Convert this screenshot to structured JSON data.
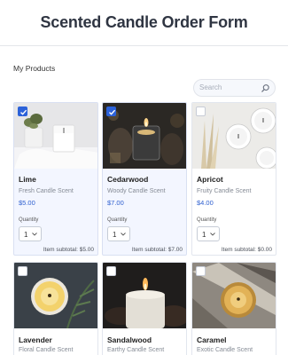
{
  "header": {
    "title": "Scented Candle Order Form"
  },
  "section": {
    "label": "My Products"
  },
  "search": {
    "placeholder": "Search"
  },
  "colors": {
    "accent": "#2c62d9",
    "price": "#2e5fcf",
    "selected_bg": "#f3f6ff"
  },
  "products": [
    {
      "name": "Lime",
      "scent": "Fresh Candle Scent",
      "price": "$5.00",
      "selected": true,
      "quantity_label": "Quantity",
      "quantity": "1",
      "subtotal_label": "Item subtotal:",
      "subtotal": "$5.00"
    },
    {
      "name": "Cedarwood",
      "scent": "Woody Candle Scent",
      "price": "$7.00",
      "selected": true,
      "quantity_label": "Quantity",
      "quantity": "1",
      "subtotal_label": "Item subtotal:",
      "subtotal": "$7.00"
    },
    {
      "name": "Apricot",
      "scent": "Fruity Candle Scent",
      "price": "$4.00",
      "selected": false,
      "quantity_label": "Quantity",
      "quantity": "1",
      "subtotal_label": "Item subtotal:",
      "subtotal": "$0.00"
    },
    {
      "name": "Lavender",
      "scent": "Floral Candle Scent",
      "selected": false
    },
    {
      "name": "Sandalwood",
      "scent": "Earthy Candle Scent",
      "selected": false
    },
    {
      "name": "Caramel",
      "scent": "Exotic Candle Scent",
      "selected": false
    }
  ]
}
